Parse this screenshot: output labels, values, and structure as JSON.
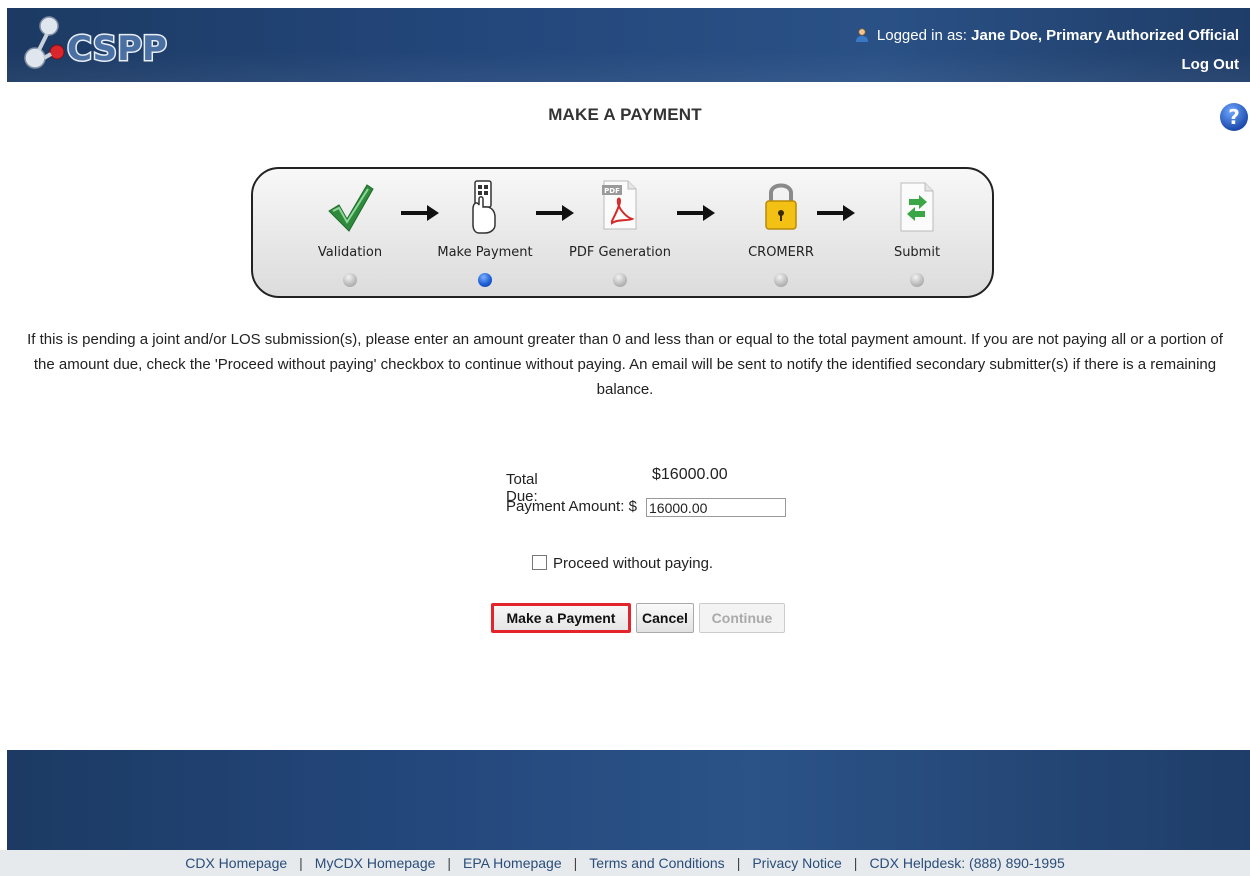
{
  "header": {
    "logo_text": "CSPP",
    "logged_in_prefix": "Logged in as:",
    "user_name": "Jane Doe, Primary Authorized Official",
    "logout_label": "Log Out"
  },
  "page_title": "MAKE A PAYMENT",
  "steps": [
    {
      "label": "Validation",
      "icon": "checkmark-icon",
      "active": false
    },
    {
      "label": "Make Payment",
      "icon": "payment-hand-icon",
      "active": true
    },
    {
      "label": "PDF Generation",
      "icon": "pdf-icon",
      "active": false
    },
    {
      "label": "CROMERR",
      "icon": "lock-icon",
      "active": false
    },
    {
      "label": "Submit",
      "icon": "submit-document-icon",
      "active": false
    }
  ],
  "instructions": "If this is pending a joint and/or LOS submission(s), please enter an amount greater than 0 and less than or equal to the total payment amount. If you are not paying all or a portion of the amount due, check the 'Proceed without paying' checkbox to continue without paying. An email will be sent to notify the identified secondary submitter(s) if there is a remaining balance.",
  "payment": {
    "total_due_label": "Total Due:",
    "total_due_value": "$16000.00",
    "amount_label": "Payment Amount: $",
    "amount_value": "16000.00"
  },
  "proceed_label": "Proceed without paying.",
  "buttons": {
    "make_payment": "Make a Payment",
    "cancel": "Cancel",
    "continue": "Continue"
  },
  "footer": {
    "links": [
      "CDX Homepage",
      "MyCDX Homepage",
      "EPA Homepage",
      "Terms and Conditions",
      "Privacy Notice",
      "CDX Helpdesk: (888) 890-1995"
    ]
  },
  "colors": {
    "header_bg": "#23467a",
    "highlight_border": "#e3252b",
    "active_step_dot": "#1d5fd6"
  }
}
